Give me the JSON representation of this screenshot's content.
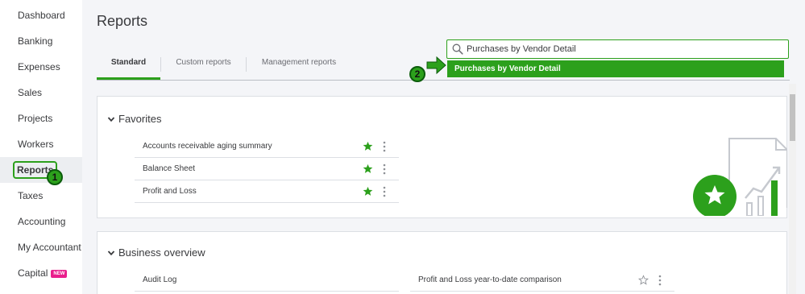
{
  "sidebar": {
    "items": [
      {
        "label": "Dashboard"
      },
      {
        "label": "Banking"
      },
      {
        "label": "Expenses"
      },
      {
        "label": "Sales"
      },
      {
        "label": "Projects"
      },
      {
        "label": "Workers"
      },
      {
        "label": "Reports"
      },
      {
        "label": "Taxes"
      },
      {
        "label": "Accounting"
      },
      {
        "label": "My Accountant"
      },
      {
        "label": "Capital",
        "badge": "NEW"
      }
    ],
    "active": "Reports"
  },
  "callouts": {
    "one": "1",
    "two": "2"
  },
  "page": {
    "title": "Reports"
  },
  "tabs": [
    {
      "label": "Standard"
    },
    {
      "label": "Custom reports"
    },
    {
      "label": "Management reports"
    }
  ],
  "search": {
    "value": "Purchases by Vendor Detail",
    "suggestion": "Purchases by Vendor Detail"
  },
  "favorites": {
    "title": "Favorites",
    "rows": [
      {
        "label": "Accounts receivable aging summary"
      },
      {
        "label": "Balance Sheet"
      },
      {
        "label": "Profit and Loss"
      }
    ]
  },
  "business_overview": {
    "title": "Business overview",
    "rows": [
      {
        "label": "Audit Log"
      },
      {
        "label": "Profit and Loss year-to-date comparison"
      }
    ]
  },
  "colors": {
    "accent": "#2ca01c",
    "badge": "#e91e8c",
    "text": "#393a3d"
  }
}
